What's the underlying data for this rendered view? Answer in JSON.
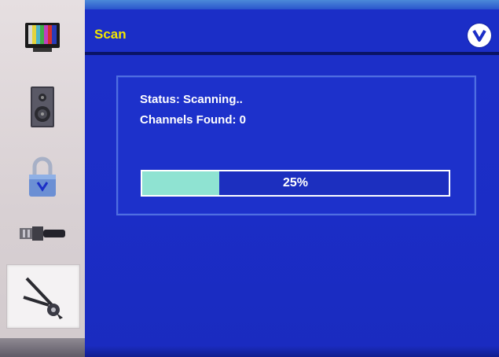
{
  "screen": {
    "title": "Scan",
    "brand_logo": "V"
  },
  "sidebar": {
    "items": [
      {
        "name": "picture",
        "icon": "tv-color-bars-icon"
      },
      {
        "name": "audio",
        "icon": "speaker-icon"
      },
      {
        "name": "parental",
        "icon": "padlock-icon"
      },
      {
        "name": "tv-input",
        "icon": "cable-connector-icon"
      },
      {
        "name": "setup",
        "icon": "wrench-tool-icon",
        "selected": true
      }
    ]
  },
  "scan": {
    "status_text": "Status: Scanning..",
    "channels_text": "Channels Found: 0",
    "progress_percent": 25,
    "progress_label": "25%"
  },
  "colors": {
    "panel_blue": "#1b2ec7",
    "title_yellow": "#f2e600",
    "progress_fill": "#8fe3d2"
  }
}
